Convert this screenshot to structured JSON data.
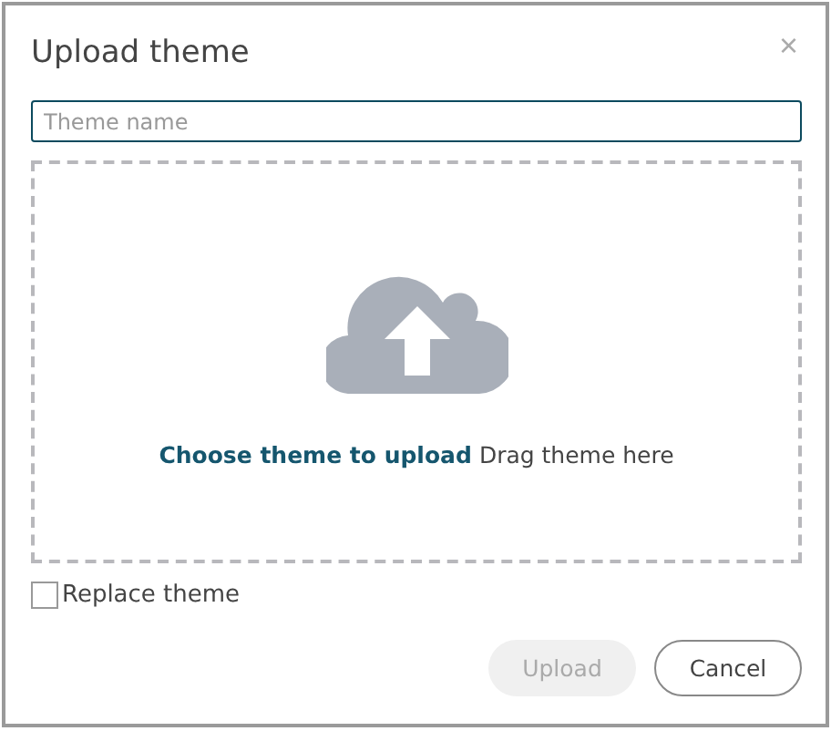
{
  "dialog": {
    "title": "Upload theme",
    "close": "×"
  },
  "name_field": {
    "placeholder": "Theme name",
    "focused": true
  },
  "drop_zone": {
    "link": "Choose theme to upload",
    "hint": "Drag theme here"
  },
  "replace_checkbox": {
    "label": "Replace theme",
    "checked": false
  },
  "buttons": [
    {
      "label": "Upload",
      "kind": "primary",
      "disabled": true
    },
    {
      "label": "Cancel",
      "kind": "secondary",
      "disabled": false
    }
  ]
}
